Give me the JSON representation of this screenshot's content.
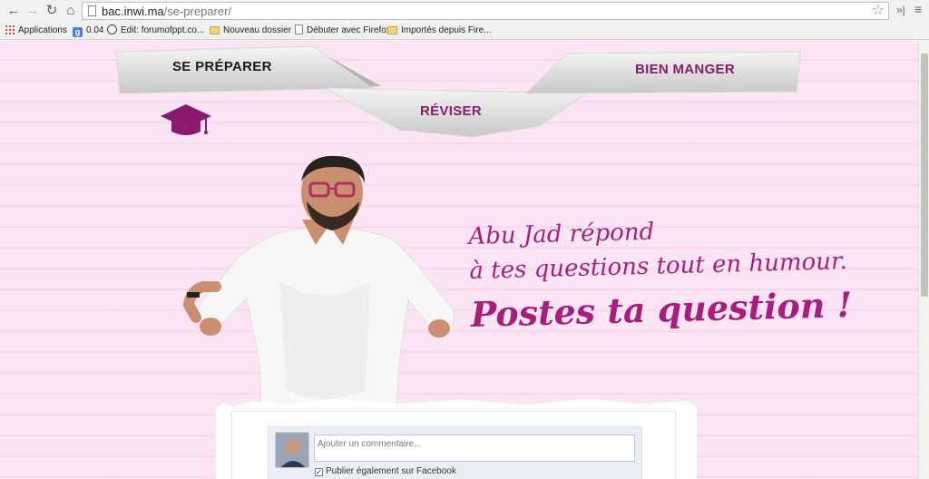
{
  "browser": {
    "url_host": "bac.inwi.ma",
    "url_path": "/se-preparer/",
    "bookmarks": [
      {
        "label": "Applications",
        "icon": "apps-icon"
      },
      {
        "label": "0.04",
        "icon": "google-icon"
      },
      {
        "label": "Edit: forumofppt.co...",
        "icon": "edit-site-icon"
      },
      {
        "label": "Nouveau dossier",
        "icon": "folder-icon"
      },
      {
        "label": "Débuter avec Firefox",
        "icon": "page-icon"
      },
      {
        "label": "Importés depuis Fire...",
        "icon": "folder-icon"
      }
    ]
  },
  "nav": {
    "se_preparer": "SE PRÉPARER",
    "reviser": "RÉVISER",
    "bien_manger": "BIEN MANGER",
    "accent_color": "#8a1a6e"
  },
  "hero": {
    "line1": "Abu Jad répond",
    "line2": "à tes questions tout en humour.",
    "line3": "Postes ta question !",
    "color": "#a71f7d"
  },
  "comment": {
    "placeholder": "Ajouter un commentaire...",
    "share_label": "Publier également sur Facebook",
    "share_checked": true
  }
}
